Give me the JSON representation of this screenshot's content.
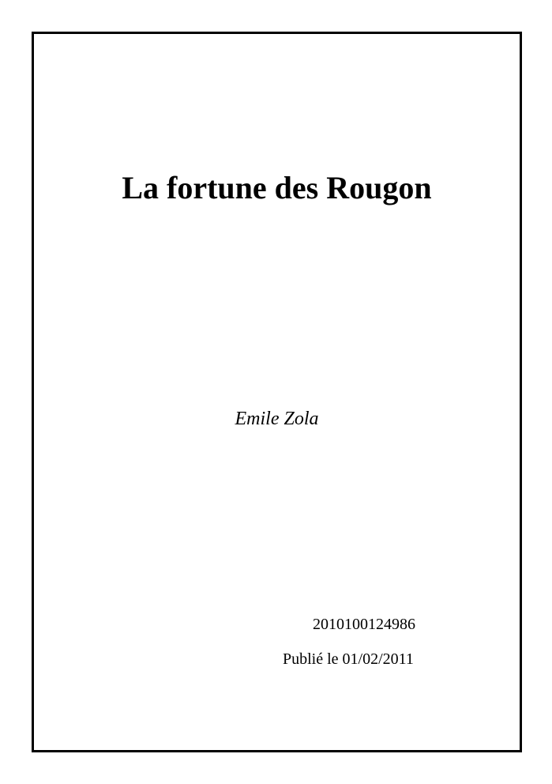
{
  "document": {
    "title": "La fortune des Rougon",
    "author": "Emile Zola",
    "identifier": "2010100124986",
    "published": "Publié le 01/02/2011"
  }
}
